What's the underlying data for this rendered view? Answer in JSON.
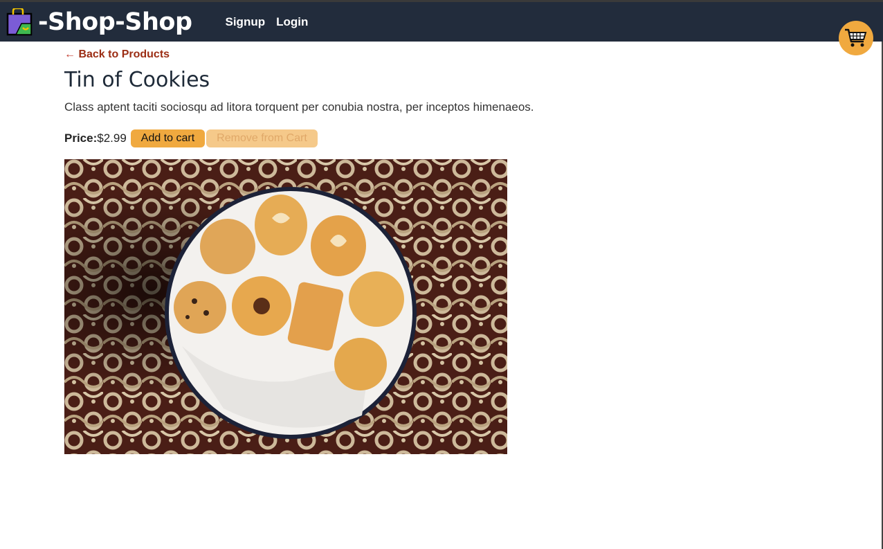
{
  "header": {
    "brand_title": "-Shop-Shop",
    "nav": [
      "Signup",
      "Login"
    ],
    "cart_icon": "shopping-cart-icon",
    "logo_icon": "shopping-bag-icon"
  },
  "product": {
    "back_link": "Back to Products",
    "back_arrow": "←",
    "name": "Tin of Cookies",
    "description": "Class aptent taciti sociosqu ad litora torquent per conubia nostra, per inceptos himenaeos.",
    "price_label": "Price:",
    "price_value": "$2.99",
    "add_button": "Add to cart",
    "remove_button": "Remove from Cart"
  },
  "colors": {
    "header_bg": "#222c3c",
    "accent": "#f0a93f",
    "back_link": "#9b2c13"
  }
}
